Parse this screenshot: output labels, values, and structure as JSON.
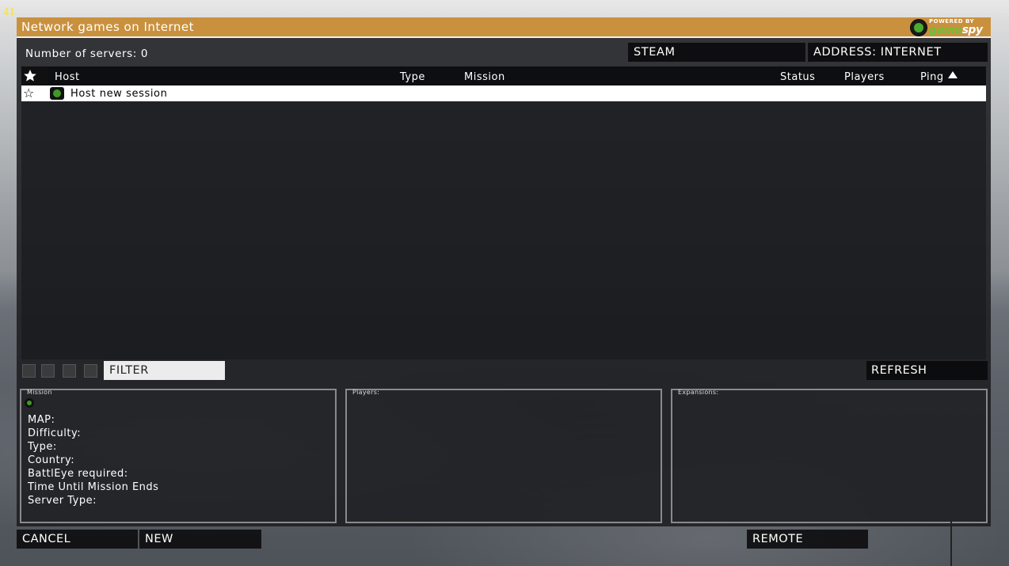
{
  "overlay": {
    "fps": "41"
  },
  "window": {
    "title": "Network games on Internet",
    "logo": {
      "powered_by": "POWERED BY",
      "brand_a": "game",
      "brand_b": "spy",
      "icon": "gamespy-globe-icon"
    }
  },
  "header": {
    "server_count": "Number of servers: 0",
    "steam_label": "STEAM",
    "address_label": "ADDRESS: INTERNET"
  },
  "list": {
    "columns": {
      "favorite_icon": "star-icon",
      "host": "Host",
      "type": "Type",
      "mission": "Mission",
      "status": "Status",
      "players": "Players",
      "ping": "Ping",
      "sort_indicator": "sort-ascending-icon"
    },
    "rows": [
      {
        "favorite": "☆",
        "icon": "server-status-icon",
        "host": "Host new session"
      }
    ]
  },
  "toolbar": {
    "icons": [
      "filter-icon-1",
      "filter-icon-2",
      "filter-icon-3",
      "filter-icon-4"
    ],
    "filter_label": "FILTER",
    "refresh_label": "REFRESH"
  },
  "details": {
    "mission": {
      "title": "Mission",
      "lines": [
        "MAP:",
        "Difficulty:",
        "Type:",
        "Country:",
        "BattlEye required:",
        "Time Until Mission Ends",
        "Server Type:"
      ]
    },
    "players": {
      "title": "Players:"
    },
    "expansions": {
      "title": "Expansions:"
    }
  },
  "footer": {
    "cancel_label": "CANCEL",
    "new_label": "NEW",
    "remote_label": "REMOTE"
  },
  "colors": {
    "titlebar": "#c9913e",
    "status_green": "#3f9a25",
    "fps_yellow": "#f4e23a"
  }
}
